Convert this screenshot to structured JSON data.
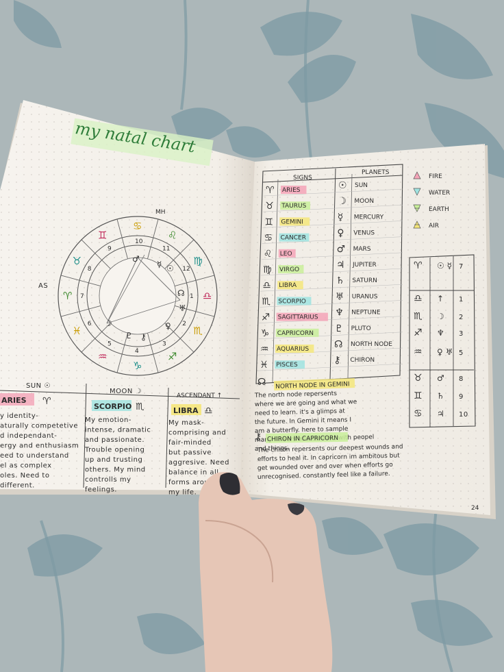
{
  "left_page": {
    "title": "my natal chart",
    "as_label": "AS",
    "mh_label": "MH",
    "house_numbers": [
      "1",
      "2",
      "3",
      "4",
      "5",
      "6",
      "7",
      "8",
      "9",
      "10",
      "11",
      "12"
    ],
    "sun": {
      "header": "SUN ☉",
      "sign": "ARIES",
      "sign_glyph": "♈",
      "lines": [
        "y identity-",
        "aturally competetive",
        "d independant-",
        "ergy and enthusiasm",
        "eed to understand",
        "el as complex",
        "oles. Need to",
        "different."
      ]
    },
    "moon": {
      "header": "MOON ☽",
      "sign": "SCORPIO",
      "sign_glyph": "♏",
      "lines": [
        "My emotion-",
        "intense, dramatic",
        "and passionate.",
        "Trouble opening",
        "up and trusting",
        "others. My mind",
        "controlls my",
        "feelings."
      ]
    },
    "ascendant": {
      "header": "ASCENDANT ↑",
      "sign": "LIBRA",
      "sign_glyph": "♎",
      "lines": [
        "My mask-",
        "comprising and",
        "fair-minded",
        "but passive",
        "aggresive. Need",
        "balance in all",
        "forms around",
        "my life."
      ]
    }
  },
  "right_page": {
    "signs_header": "SIGNS",
    "planets_header": "PLANETS",
    "signs": [
      {
        "glyph": "♈",
        "name": "ARIES",
        "color": "#f4a3b7"
      },
      {
        "glyph": "♉",
        "name": "TAURUS",
        "color": "#c9ef9a"
      },
      {
        "glyph": "♊",
        "name": "GEMINI",
        "color": "#f5e67a"
      },
      {
        "glyph": "♋",
        "name": "CANCER",
        "color": "#9fe3e0"
      },
      {
        "glyph": "♌",
        "name": "LEO",
        "color": "#f4a3b7"
      },
      {
        "glyph": "♍",
        "name": "VIRGO",
        "color": "#c9ef9a"
      },
      {
        "glyph": "♎",
        "name": "LIBRA",
        "color": "#f5e67a"
      },
      {
        "glyph": "♏",
        "name": "SCORPIO",
        "color": "#9fe3e0"
      },
      {
        "glyph": "♐",
        "name": "SAGITTARIUS",
        "color": "#f4a3b7"
      },
      {
        "glyph": "♑",
        "name": "CAPRICORN",
        "color": "#c9ef9a"
      },
      {
        "glyph": "♒",
        "name": "AQUARIUS",
        "color": "#f5e67a"
      },
      {
        "glyph": "♓",
        "name": "PISCES",
        "color": "#9fe3e0"
      }
    ],
    "planets": [
      {
        "glyph": "☉",
        "name": "SUN"
      },
      {
        "glyph": "☽",
        "name": "MOON"
      },
      {
        "glyph": "☿",
        "name": "MERCURY"
      },
      {
        "glyph": "♀",
        "name": "VENUS"
      },
      {
        "glyph": "♂",
        "name": "MARS"
      },
      {
        "glyph": "♃",
        "name": "JUPITER"
      },
      {
        "glyph": "♄",
        "name": "SATURN"
      },
      {
        "glyph": "♅",
        "name": "URANUS"
      },
      {
        "glyph": "♆",
        "name": "NEPTUNE"
      },
      {
        "glyph": "♇",
        "name": "PLUTO"
      },
      {
        "glyph": "☊",
        "name": "NORTH NODE"
      },
      {
        "glyph": "⚷",
        "name": "CHIRON"
      }
    ],
    "elements": [
      {
        "name": "FIRE",
        "color": "#f4a3b7"
      },
      {
        "name": "WATER",
        "color": "#9fe3e0"
      },
      {
        "name": "EARTH",
        "color": "#c9ef9a"
      },
      {
        "name": "AIR",
        "color": "#f5e67a"
      }
    ],
    "placements": [
      {
        "sign": "♈",
        "planet": "☉ ☿",
        "house": "7"
      },
      {
        "sign": "♎",
        "planet": "↑",
        "house": "1"
      },
      {
        "sign": "♏",
        "planet": "☽",
        "house": "2"
      },
      {
        "sign": "♐",
        "planet": "♆",
        "house": "3"
      },
      {
        "sign": "♒",
        "planet": "♀ ♅",
        "house": "5"
      },
      {
        "sign": "♉",
        "planet": "♂",
        "house": "8"
      },
      {
        "sign": "♊",
        "planet": "♄",
        "house": "9"
      },
      {
        "sign": "♋",
        "planet": "♃",
        "house": "10"
      }
    ],
    "north_node": {
      "heading": "NORTH NODE IN GEMINI",
      "lines": [
        "The north node repersents",
        "where we are going and what we",
        "need to learn. it's a glimps at",
        "the future. In Gemini it means I",
        "am a butterfly. here to sample",
        "many flowers and connect with peopel",
        "and things."
      ]
    },
    "chiron": {
      "heading": "CHIRON IN CAPRICORN",
      "lines": [
        "The chiron repersents our deepest wounds and",
        "efforts to heal it. In capricorn im ambitous but",
        "get wounded over and over when efforts go",
        "unrecognised. constantly feel like a failure."
      ]
    },
    "page_number": "24"
  }
}
